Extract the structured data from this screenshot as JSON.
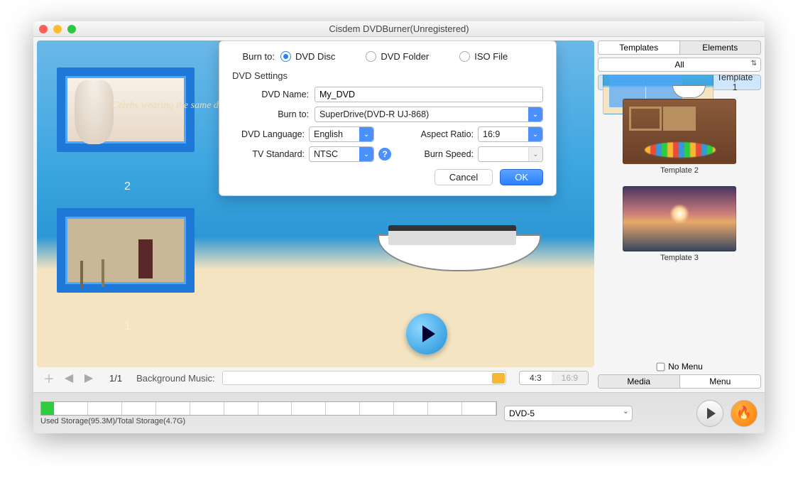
{
  "window": {
    "title": "Cisdem DVDBurner(Unregistered)"
  },
  "dialog": {
    "burn_to_label": "Burn to:",
    "opts": {
      "disc": "DVD Disc",
      "folder": "DVD Folder",
      "iso": "ISO File"
    },
    "settings_header": "DVD Settings",
    "dvd_name_label": "DVD Name:",
    "dvd_name_value": "My_DVD",
    "burn_to_drive_label": "Burn to:",
    "burn_to_drive_value": "SuperDrive(DVD-R   UJ-868)",
    "dvd_language_label": "DVD Language:",
    "dvd_language_value": "English",
    "aspect_label": "Aspect Ratio:",
    "aspect_value": "16:9",
    "tv_label": "TV Standard:",
    "tv_value": "NTSC",
    "speed_label": "Burn Speed:",
    "speed_value": "",
    "cancel": "Cancel",
    "ok": "OK"
  },
  "preview": {
    "clip1_caption": "Celebs wearing the same dress",
    "num1": "1",
    "num2": "2"
  },
  "toolbar": {
    "page": "1/1",
    "bgmusic_label": "Background Music:",
    "aspect43": "4:3",
    "aspect169": "16:9"
  },
  "bottom": {
    "storage_text": "Used Storage(95.3M)/Total Storage(4.7G)",
    "dvd_type": "DVD-5"
  },
  "sidebar": {
    "tab_templates": "Templates",
    "tab_elements": "Elements",
    "all_label": "All",
    "tpl1": "Template 1",
    "tpl2": "Template 2",
    "tpl3": "Template 3",
    "nomenu": "No Menu",
    "tab_media": "Media",
    "tab_menu": "Menu"
  }
}
